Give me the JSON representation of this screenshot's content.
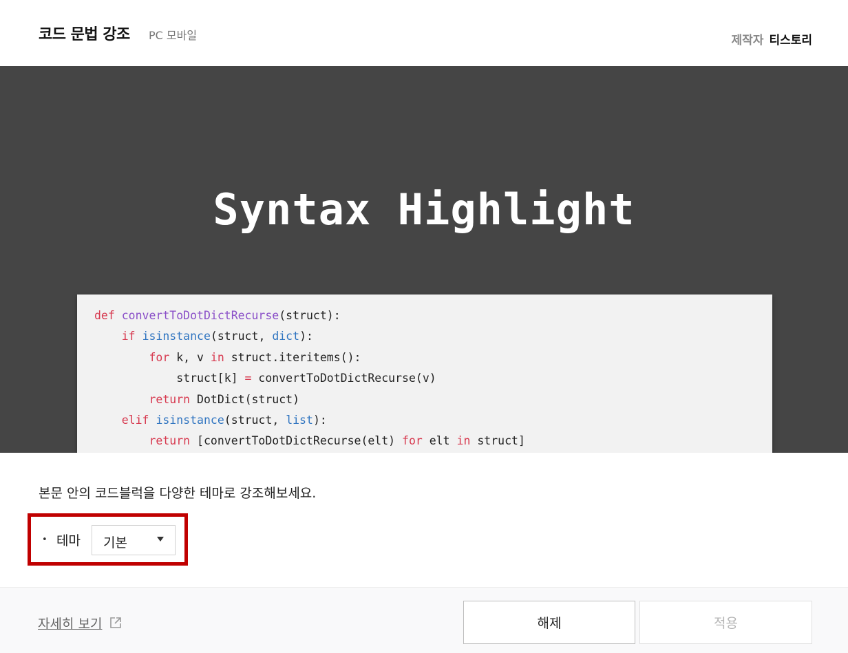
{
  "header": {
    "title": "코드 문법 강조",
    "subtitle": "PC 모바일",
    "maker_label": "제작자",
    "maker_name": "티스토리"
  },
  "preview": {
    "heading": "Syntax Highlight",
    "code_lines": [
      "def convertToDotDictRecurse(struct):",
      "    if isinstance(struct, dict):",
      "        for k, v in struct.iteritems():",
      "            struct[k] = convertToDotDictRecurse(v)",
      "        return DotDict(struct)",
      "    elif isinstance(struct, list):",
      "        return [convertToDotDictRecurse(elt) for elt in struct]"
    ]
  },
  "description": "본문 안의 코드블럭을 다양한 테마로 강조해보세요.",
  "theme": {
    "bullet": "•",
    "label": "테마",
    "selected": "기본"
  },
  "footer": {
    "detail_link": "자세히 보기",
    "release_button": "해제",
    "apply_button": "적용"
  },
  "colors": {
    "preview_bg": "#454545",
    "code_bg": "#f2f2f2",
    "keyword": "#d7394f",
    "function_name": "#8a4fc8",
    "builtin": "#2f74c0",
    "highlight_box": "#c00000"
  },
  "icons": {
    "external_link": "external-link-icon",
    "dropdown": "caret-down-icon"
  }
}
